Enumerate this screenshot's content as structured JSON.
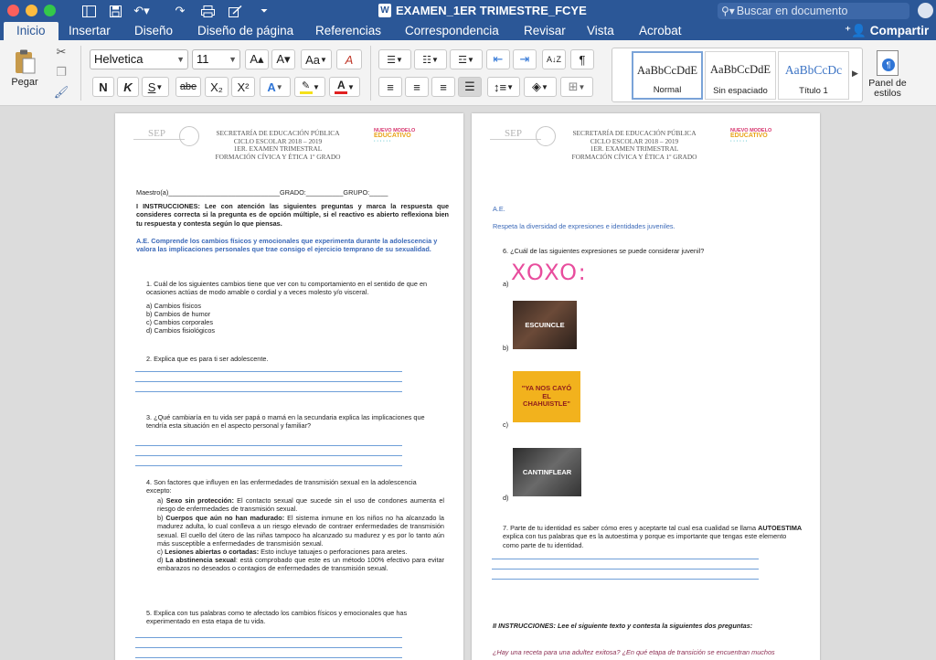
{
  "app": {
    "doc_title": "EXAMEN_1ER TRIMESTRE_FCYE",
    "doc_icon": "W",
    "search_placeholder": "Buscar en documento",
    "share_label": "Compartir"
  },
  "tabs": [
    "Inicio",
    "Insertar",
    "Diseño",
    "Diseño de página",
    "Referencias",
    "Correspondencia",
    "Revisar",
    "Vista",
    "Acrobat"
  ],
  "ribbon": {
    "paste_label": "Pegar",
    "font_name": "Helvetica",
    "font_size": "11",
    "styles": [
      {
        "sample": "AaBbCcDdE",
        "label": "Normal"
      },
      {
        "sample": "AaBbCcDdE",
        "label": "Sin espaciado"
      },
      {
        "sample": "AaBbCcDc",
        "label": "Título 1"
      }
    ],
    "styles_pane_label": "Panel de estilos",
    "bold_glyph": "N",
    "italic_glyph": "K",
    "underline_glyph": "S",
    "strike_glyph": "abe",
    "subscript_glyph": "X₂",
    "superscript_glyph": "X²",
    "grow_glyph": "A▴",
    "shrink_glyph": "A▾",
    "case_glyph": "Aa",
    "clear_glyph": "A",
    "pilcrow_glyph": "¶",
    "highlight_color": "#f5e11a",
    "font_color": "#e02020"
  },
  "header": {
    "sep": "SEP",
    "lines": [
      "SECRETARÍA DE EDUCACIÓN PÚBLICA",
      "CICLO ESCOLAR 2018 – 2019",
      "1ER. EXAMEN TRIMESTRAL",
      "FORMACIÓN CÍVICA Y ÉTICA 1º GRADO"
    ],
    "logo_lines": [
      "NUEVO MODELO",
      "EDUCATIVO",
      "· · · · · ·"
    ]
  },
  "page1": {
    "maestro": "Maestro(a)______________________________GRADO:__________GRUPO:_____",
    "instrucciones": "I INSTRUCCIONES: Lee con atención las siguientes preguntas y marca la respuesta que consideres correcta si la pregunta es de opción múltiple, si el reactivo  es abierto reflexiona bien tu respuesta y contesta según lo que piensas.",
    "ae": "A.E. Comprende los cambios físicos y emocionales que experimenta durante la adolescencia y valora las implicaciones personales que trae consigo el ejercicio temprano de su sexualidad.",
    "q1": "1.   Cuál de los siguientes cambios tiene que ver con tu comportamiento en el sentido de que en ocasiones actúas de modo amable o  cordial y a veces molesto y/o visceral.",
    "q1_options": [
      "a)  Cambios físicos",
      "b)  Cambios de humor",
      "c)  Cambios corporales",
      "d)  Cambios fisiológicos"
    ],
    "q2": "2.   Explica que es para ti ser adolescente.",
    "q3": "3.   ¿Qué cambiaría en tu vida ser papá o mamá en la secundaria explica las implicaciones que tendría esta situación en el aspecto personal y familiar?",
    "q4": "4.   Son factores que influyen en  las enfermedades de transmisión sexual en la adolescencia excepto:",
    "q4_options": [
      {
        "letter": "a)",
        "bold": "Sexo sin protección:",
        "text": " El contacto sexual que sucede sin el uso de condones aumenta el riesgo de enfermedades de transmisión sexual."
      },
      {
        "letter": "b)",
        "bold": "Cuerpos que aún no han madurado:",
        "text": " El sistema inmune en los niños no ha alcanzado la madurez adulta, lo cual conlleva a un riesgo elevado de contraer enfermedades de transmisión sexual. El cuello del útero de las niñas tampoco ha alcanzado su madurez y es por lo tanto aún más susceptible a enfermedades de transmisión sexual."
      },
      {
        "letter": "c)",
        "bold": "Lesiones abiertas o cortadas:",
        "text": " Esto incluye tatuajes o perforaciones para aretes."
      },
      {
        "letter": "d)",
        "bold": "La abstinencia sexual",
        "text": ": está comprobado que este es un método 100% efectivo para evitar embarazos no deseados o contagios de enfermedades de transmisión sexual."
      }
    ],
    "q5": "5.   Explica con tus palabras como te afectado los cambios físicos y emocionales que has experimentado en esta etapa de tu vida."
  },
  "page2": {
    "ae_title": "A.E.",
    "ae_text": "Respeta la diversidad de expresiones e identidades juveniles.",
    "q6": "6.   ¿Cuál de las siguientes expresiones se puede considerar juvenil?",
    "opt_a_label": "a)",
    "opt_a_text": "XOXO:",
    "opt_b_label": "b)",
    "opt_b_text": "ESCUINCLE",
    "opt_c_label": "c)",
    "opt_c_text": "\"YA NOS CAYÓ EL CHAHUISTLE\"",
    "opt_d_label": "d)",
    "opt_d_text": "CANTINFLEAR",
    "q7_a": "7.   Parte de tu identidad es saber cómo eres y aceptarte tal cual esa cualidad se llama",
    "q7_bold": "AUTOESTIMA",
    "q7_b": " explica con tus palabras que es la autoestima y porque es importante que tengas este elemento como parte de tu identidad.",
    "ii_instrucciones": "II INSTRUCCIONES: Lee el siguiente texto  y contesta la siguientes dos preguntas:",
    "reading": "¿Hay una receta para una adultez exitosa? ¿En qué etapa de transición se encuentran muchos"
  }
}
